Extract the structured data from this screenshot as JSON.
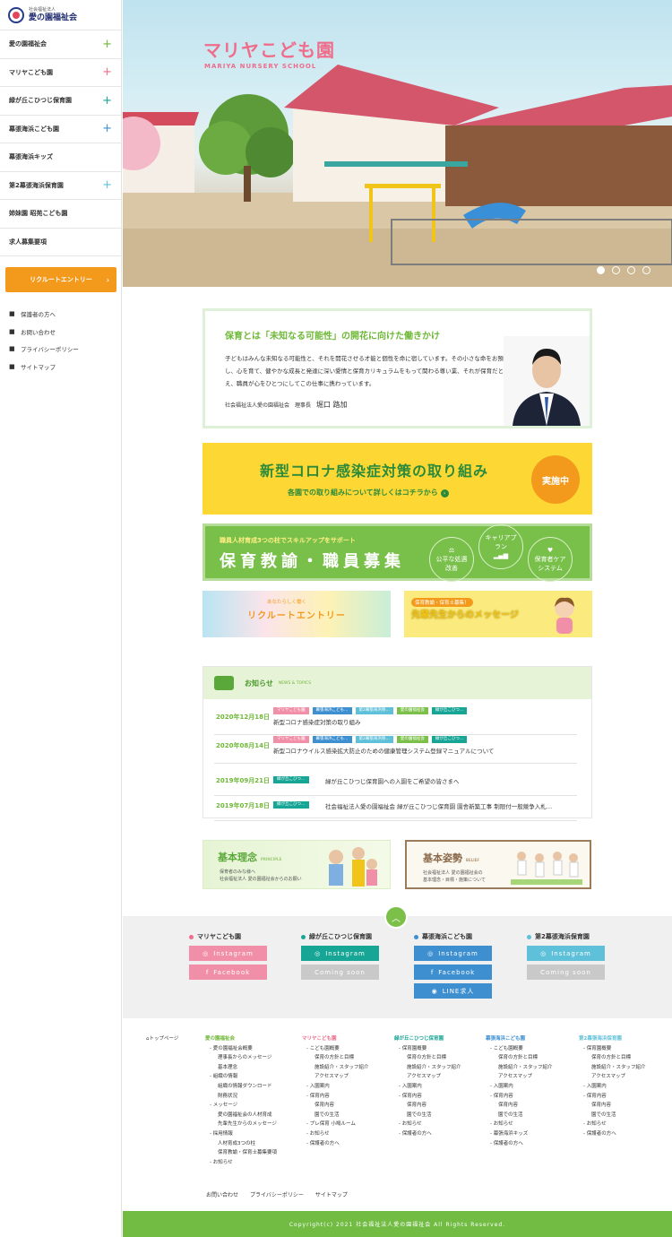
{
  "logo": {
    "small": "社会福祉法人",
    "name": "愛の園福祉会"
  },
  "sidebar": {
    "items": [
      {
        "label": "愛の園福祉会",
        "plus": "+",
        "color": "#6fb838"
      },
      {
        "label": "マリヤこども園",
        "plus": "+",
        "color": "#ef6d8a"
      },
      {
        "label": "緑が丘こひつじ保育園",
        "plus": "+",
        "color": "#17a596"
      },
      {
        "label": "幕張海浜こども園",
        "plus": "+",
        "color": "#3d8fd0"
      },
      {
        "label": "幕張海浜キッズ",
        "plus": "",
        "color": "#3d8fd0"
      },
      {
        "label": "第2幕張海浜保育園",
        "plus": "+",
        "color": "#5fc0d9"
      },
      {
        "label": "姉妹園 昭苑こども園",
        "plus": "",
        "color": "#333"
      },
      {
        "label": "求人募集要項",
        "plus": "",
        "color": "#333"
      }
    ],
    "recruit_button": "リクルートエントリー",
    "recruit_arrow": "›",
    "sub_links": [
      {
        "icon": "family-icon",
        "glyph": "👪",
        "label": "保護者の方へ"
      },
      {
        "icon": "mail-icon",
        "glyph": "✉",
        "label": "お問い合わせ"
      },
      {
        "icon": "lock-icon",
        "glyph": "🔒",
        "label": "プライバシーポリシー"
      },
      {
        "icon": "sitemap-icon",
        "glyph": "⊞",
        "label": "サイトマップ"
      }
    ]
  },
  "hero": {
    "title": "マリヤこども園",
    "subtitle": "MARIYA NURSERY SCHOOL",
    "slides": 4,
    "active_slide": 1
  },
  "message": {
    "heading": "保育とは「未知なる可能性」の開花に向けた働きかけ",
    "body": "子どもはみんな未知なる可能性と、それを開花させる才能と個性を命に宿しています。その小さな命をお預かりし、心を育て、健やかな成長と発達に深い愛情と保育カリキュラムをもって関わる尊い業、それが保育だと考え、職員が心をひとつにしてこの仕事に携わっています。",
    "sign_org": "社会福祉法人愛の園福祉会　理事長",
    "sign_name": "堀口 路加"
  },
  "corona": {
    "heading": "新型コロナ感染症対策の取り組み",
    "sub": "各園での取り組みについて詳しくはコチラから",
    "badge": "実施中"
  },
  "staff": {
    "sub": "職員人材育成3つの柱でスキルアップをサポート",
    "heading": "保育教諭・職員募集",
    "pillars": [
      "公平な処遇改善",
      "キャリアプラン",
      "保育者ケアシステム"
    ]
  },
  "entry": {
    "sub": "あなたらしく働く",
    "title": "リクルートエントリー"
  },
  "senpai": {
    "sub": "保育教諭・保育士募集！",
    "title": "先輩先生からのメッセージ"
  },
  "news": {
    "title": "お知らせ",
    "title_en": "NEWS & TOPICS",
    "rows": [
      {
        "date": "2020年12月18日",
        "tags": [
          {
            "t": "マリヤこども園",
            "c": "#f28fa8"
          },
          {
            "t": "幕張海浜こども…",
            "c": "#3d8fd0"
          },
          {
            "t": "第2幕張海浜保…",
            "c": "#5fc0d9"
          },
          {
            "t": "愛の園福祉会",
            "c": "#7cc04a"
          },
          {
            "t": "緑が丘こひつ…",
            "c": "#17a596"
          }
        ],
        "title": "新型コロナ感染症対策の取り組み"
      },
      {
        "date": "2020年08月14日",
        "tags": [
          {
            "t": "マリヤこども園",
            "c": "#f28fa8"
          },
          {
            "t": "幕張海浜こども…",
            "c": "#3d8fd0"
          },
          {
            "t": "第2幕張海浜保…",
            "c": "#5fc0d9"
          },
          {
            "t": "愛の園福祉会",
            "c": "#7cc04a"
          },
          {
            "t": "緑が丘こひつ…",
            "c": "#17a596"
          }
        ],
        "title": "新型コロナウイルス感染拡大防止のための健康管理システム登録マニュアルについて"
      },
      {
        "date": "2019年09月21日",
        "tags": [
          {
            "t": "緑が丘こひつ…",
            "c": "#17a596"
          }
        ],
        "title": "緑が丘こひつじ保育園への入園をご希望の皆さまへ"
      },
      {
        "date": "2019年07月18日",
        "tags": [
          {
            "t": "緑が丘こひつ…",
            "c": "#17a596"
          }
        ],
        "title": "社会福祉法人愛の園福祉会 緑が丘こひつじ保育園 園舎新築工事 制限付一般競争入札…"
      }
    ]
  },
  "principle": {
    "title": "基本理念",
    "en": "PRINCIPLE",
    "desc1": "保育者のみな様へ",
    "desc2": "社会福祉法人 愛の園福祉会からのお願い"
  },
  "stance": {
    "title": "基本姿勢",
    "en": "BELIEF",
    "desc1": "社会福祉法人 愛の園福祉会の",
    "desc2": "基本理念・目標・施策について"
  },
  "sns": {
    "columns": [
      {
        "title": "マリヤこども園",
        "color": "#ef6d8a",
        "buttons": [
          {
            "label": "Instagram",
            "icon": "◎",
            "bg": "#f28fa8"
          },
          {
            "label": "Facebook",
            "icon": "f",
            "bg": "#f28fa8"
          }
        ]
      },
      {
        "title": "緑が丘こひつじ保育園",
        "color": "#17a596",
        "buttons": [
          {
            "label": "Instagram",
            "icon": "◎",
            "bg": "#17a596"
          },
          {
            "label": "Coming soon",
            "icon": "",
            "bg": "#c9c9c9"
          }
        ]
      },
      {
        "title": "幕張海浜こども園",
        "color": "#3d8fd0",
        "buttons": [
          {
            "label": "Instagram",
            "icon": "◎",
            "bg": "#3d8fd0"
          },
          {
            "label": "Facebook",
            "icon": "f",
            "bg": "#3d8fd0"
          },
          {
            "label": "LINE求人",
            "icon": "◉",
            "bg": "#3d8fd0"
          }
        ]
      },
      {
        "title": "第2幕張海浜保育園",
        "color": "#5fc0d9",
        "buttons": [
          {
            "label": "Instagram",
            "icon": "◎",
            "bg": "#5fc0d9"
          },
          {
            "label": "Coming soon",
            "icon": "",
            "bg": "#c9c9c9"
          }
        ]
      }
    ]
  },
  "sitemap": {
    "top": "トップページ",
    "cols": [
      {
        "head": "愛の園福祉会",
        "color": "#6fb838",
        "items": [
          [
            "i1",
            "愛の園福祉会概要"
          ],
          [
            "i2",
            "理事長からのメッセージ"
          ],
          [
            "i2",
            "基本理念"
          ],
          [
            "i1",
            "組織の情報"
          ],
          [
            "i2",
            "組織の情報ダウンロード"
          ],
          [
            "i2",
            "財務状況"
          ],
          [
            "i1",
            "メッセージ"
          ],
          [
            "i2",
            "愛の園福祉会の人材育成"
          ],
          [
            "i2",
            "先輩先生からのメッセージ"
          ],
          [
            "i1",
            "採用情報"
          ],
          [
            "i2",
            "人材育成3つの柱"
          ],
          [
            "i2",
            "保育教諭・保育士募集要項"
          ],
          [
            "i1",
            "お知らせ"
          ]
        ]
      },
      {
        "head": "マリヤこども園",
        "color": "#ef6d8a",
        "items": [
          [
            "i1",
            "こども園概要"
          ],
          [
            "i2",
            "保育の方針と目標"
          ],
          [
            "i2",
            "施設紹介・スタッフ紹介"
          ],
          [
            "i2",
            "アクセスマップ"
          ],
          [
            "i1",
            "入園案内"
          ],
          [
            "i1",
            "保育内容"
          ],
          [
            "i2",
            "保育内容"
          ],
          [
            "i2",
            "園での生活"
          ],
          [
            "i1",
            "プレ保育 小鳩ルーム"
          ],
          [
            "i1",
            "お知らせ"
          ],
          [
            "i1",
            "保護者の方へ"
          ]
        ]
      },
      {
        "head": "緑が丘こひつじ保育園",
        "color": "#17a596",
        "items": [
          [
            "i1",
            "保育園概要"
          ],
          [
            "i2",
            "保育の方針と目標"
          ],
          [
            "i2",
            "施設紹介・スタッフ紹介"
          ],
          [
            "i2",
            "アクセスマップ"
          ],
          [
            "i1",
            "入園案内"
          ],
          [
            "i1",
            "保育内容"
          ],
          [
            "i2",
            "保育内容"
          ],
          [
            "i2",
            "園での生活"
          ],
          [
            "i1",
            "お知らせ"
          ],
          [
            "i1",
            "保護者の方へ"
          ]
        ]
      },
      {
        "head": "幕張海浜こども園",
        "color": "#3d8fd0",
        "items": [
          [
            "i1",
            "こども園概要"
          ],
          [
            "i2",
            "保育の方針と目標"
          ],
          [
            "i2",
            "施設紹介・スタッフ紹介"
          ],
          [
            "i2",
            "アクセスマップ"
          ],
          [
            "i1",
            "入園案内"
          ],
          [
            "i1",
            "保育内容"
          ],
          [
            "i2",
            "保育内容"
          ],
          [
            "i2",
            "園での生活"
          ],
          [
            "i1",
            "お知らせ"
          ],
          [
            "i1",
            "幕張海浜キッズ"
          ],
          [
            "i1",
            "保護者の方へ"
          ]
        ]
      },
      {
        "head": "第2幕張海浜保育園",
        "color": "#5fc0d9",
        "items": [
          [
            "i1",
            "保育園概要"
          ],
          [
            "i2",
            "保育の方針と目標"
          ],
          [
            "i2",
            "施設紹介・スタッフ紹介"
          ],
          [
            "i2",
            "アクセスマップ"
          ],
          [
            "i1",
            "入園案内"
          ],
          [
            "i1",
            "保育内容"
          ],
          [
            "i2",
            "保育内容"
          ],
          [
            "i2",
            "園での生活"
          ],
          [
            "i1",
            "お知らせ"
          ],
          [
            "i1",
            "保護者の方へ"
          ]
        ]
      }
    ]
  },
  "bottom_links": [
    "お問い合わせ",
    "プライバシーポリシー",
    "サイトマップ"
  ],
  "copyright": "Copyright(c) 2021 社会福祉法人愛の園福祉会 All Rights Reserved."
}
